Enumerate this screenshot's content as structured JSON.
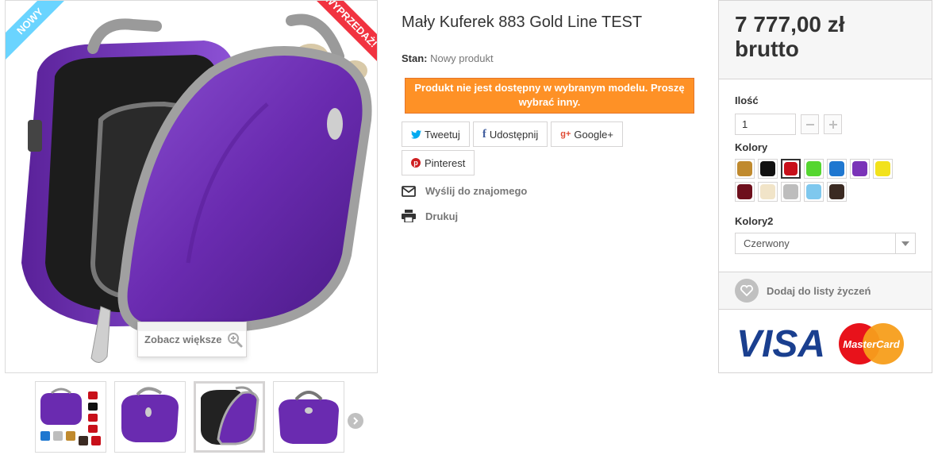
{
  "product": {
    "title": "Mały Kuferek 883 Gold Line TEST",
    "condition_label": "Stan:",
    "condition_value": "Nowy produkt",
    "availability_message": "Produkt nie jest dostępny w wybranym modelu. Proszę wybrać inny.",
    "badge_new": "NOWY",
    "badge_sale": "WYPRZEDAŻ!",
    "zoom_label": "Zobacz większe"
  },
  "share": {
    "tweet": "Tweetuj",
    "facebook": "Udostępnij",
    "google": "Google+",
    "pinterest": "Pinterest"
  },
  "actions": {
    "send_friend": "Wyślij do znajomego",
    "print": "Drukuj"
  },
  "buybox": {
    "price": "7 777,00 zł",
    "price_suffix": "brutto",
    "qty_label": "Ilość",
    "qty_value": "1",
    "colors_label": "Kolory",
    "colors": [
      {
        "name": "brown",
        "hex": "#c08a2e"
      },
      {
        "name": "black",
        "hex": "#111111"
      },
      {
        "name": "red",
        "hex": "#c8101a"
      },
      {
        "name": "green",
        "hex": "#55d630"
      },
      {
        "name": "blue",
        "hex": "#1f77d0"
      },
      {
        "name": "purple",
        "hex": "#7a33b8"
      },
      {
        "name": "yellow",
        "hex": "#f2e21c"
      },
      {
        "name": "burgundy",
        "hex": "#6e0f1c"
      },
      {
        "name": "cream",
        "hex": "#f1e4c8"
      },
      {
        "name": "silver",
        "hex": "#bdbdbd"
      },
      {
        "name": "light-blue",
        "hex": "#7fc8ee"
      },
      {
        "name": "dark-brown",
        "hex": "#3b2a22"
      }
    ],
    "selected_color_index": 2,
    "colors2_label": "Kolory2",
    "colors2_value": "Czerwony",
    "wishlist": "Dodaj do listy życzeń",
    "cards_visa": "VISA",
    "cards_mastercard": "MasterCard"
  },
  "thumbnails": {
    "count": 4,
    "active_index": 2
  },
  "colors": {
    "accent_orange": "#fe9126",
    "ribbon_new": "#6ad4ff",
    "ribbon_sale": "#f13340",
    "bag_purple": "#6a2bb0"
  }
}
